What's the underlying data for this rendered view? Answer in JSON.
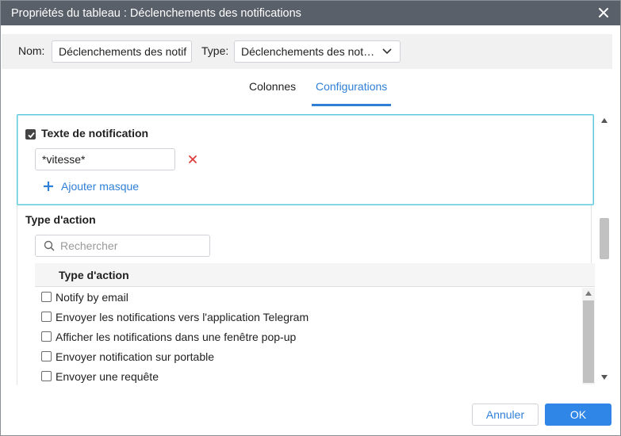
{
  "dialog": {
    "title": "Propriétés du tableau : Déclenchements des notifications"
  },
  "header": {
    "name_label": "Nom:",
    "name_value": "Déclenchements des notif",
    "type_label": "Type:",
    "type_value": "Déclenchements des notifications"
  },
  "tabs": [
    {
      "label": "Colonnes",
      "active": false
    },
    {
      "label": "Configurations",
      "active": true
    }
  ],
  "notification_text": {
    "checkbox_label": "Texte de notification",
    "checked": true,
    "mask_value": "*vitesse*",
    "add_mask_label": "Ajouter masque"
  },
  "action_type": {
    "section_title": "Type d'action",
    "search_placeholder": "Rechercher",
    "column_header": "Type d'action",
    "items": [
      {
        "label": "Notify by email",
        "checked": false
      },
      {
        "label": "Envoyer les notifications vers l'application Telegram",
        "checked": false
      },
      {
        "label": "Afficher les notifications dans une fenêtre pop-up",
        "checked": false
      },
      {
        "label": "Envoyer notification sur portable",
        "checked": false
      },
      {
        "label": "Envoyer une requête",
        "checked": false
      }
    ]
  },
  "footer": {
    "cancel_label": "Annuler",
    "ok_label": "OK"
  },
  "colors": {
    "titlebar": "#5a606a",
    "accent": "#2f7fd6",
    "ok_button": "#2f86e6",
    "focus_border": "#5bc8dc",
    "delete": "#e03c3c"
  }
}
